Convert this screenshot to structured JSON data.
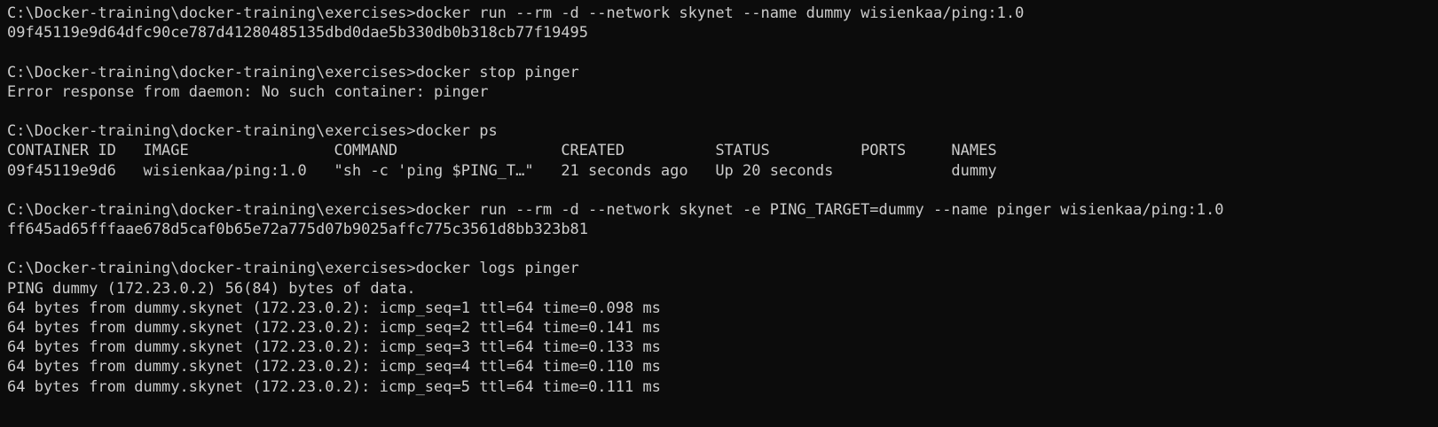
{
  "terminal": {
    "lines": [
      "C:\\Docker-training\\docker-training\\exercises>docker run --rm -d --network skynet --name dummy wisienkaa/ping:1.0",
      "09f45119e9d64dfc90ce787d41280485135dbd0dae5b330db0b318cb77f19495",
      "",
      "C:\\Docker-training\\docker-training\\exercises>docker stop pinger",
      "Error response from daemon: No such container: pinger",
      "",
      "C:\\Docker-training\\docker-training\\exercises>docker ps",
      "CONTAINER ID   IMAGE                COMMAND                  CREATED          STATUS          PORTS     NAMES",
      "09f45119e9d6   wisienkaa/ping:1.0   \"sh -c 'ping $PING_T…\"   21 seconds ago   Up 20 seconds             dummy",
      "",
      "C:\\Docker-training\\docker-training\\exercises>docker run --rm -d --network skynet -e PING_TARGET=dummy --name pinger wisienkaa/ping:1.0",
      "ff645ad65fffaae678d5caf0b65e72a775d07b9025affc775c3561d8bb323b81",
      "",
      "C:\\Docker-training\\docker-training\\exercises>docker logs pinger",
      "PING dummy (172.23.0.2) 56(84) bytes of data.",
      "64 bytes from dummy.skynet (172.23.0.2): icmp_seq=1 ttl=64 time=0.098 ms",
      "64 bytes from dummy.skynet (172.23.0.2): icmp_seq=2 ttl=64 time=0.141 ms",
      "64 bytes from dummy.skynet (172.23.0.2): icmp_seq=3 ttl=64 time=0.133 ms",
      "64 bytes from dummy.skynet (172.23.0.2): icmp_seq=4 ttl=64 time=0.110 ms",
      "64 bytes from dummy.skynet (172.23.0.2): icmp_seq=5 ttl=64 time=0.111 ms"
    ]
  },
  "colors": {
    "background": "#0c0c0c",
    "foreground": "#cccccc"
  }
}
